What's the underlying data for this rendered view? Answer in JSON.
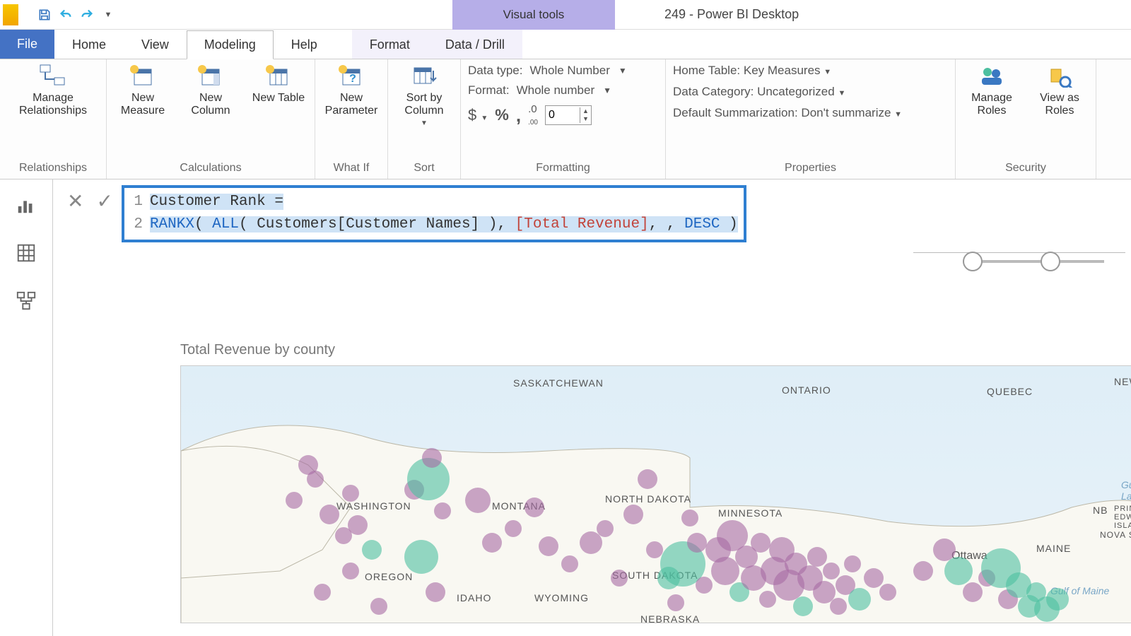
{
  "title_bar": {
    "visual_tools": "Visual tools",
    "app_title": "249 - Power BI Desktop"
  },
  "tabs": {
    "file": "File",
    "home": "Home",
    "view": "View",
    "modeling": "Modeling",
    "help": "Help",
    "format": "Format",
    "data_drill": "Data / Drill",
    "active": "Modeling"
  },
  "ribbon": {
    "relationships": {
      "manage": "Manage Relationships",
      "group": "Relationships"
    },
    "calculations": {
      "new_measure": "New Measure",
      "new_column": "New Column",
      "new_table": "New Table",
      "group": "Calculations"
    },
    "whatif": {
      "new_parameter": "New Parameter",
      "group": "What If"
    },
    "sort": {
      "sort_by_column": "Sort by Column",
      "group": "Sort"
    },
    "formatting": {
      "data_type_label": "Data type:",
      "data_type_value": "Whole Number",
      "format_label": "Format:",
      "format_value": "Whole number",
      "currency": "$",
      "percent": "%",
      "comma": ",",
      "decimals_icon": ".00",
      "decimals_value": "0",
      "group": "Formatting"
    },
    "properties": {
      "home_table_label": "Home Table:",
      "home_table_value": "Key Measures",
      "data_category_label": "Data Category:",
      "data_category_value": "Uncategorized",
      "default_summ_label": "Default Summarization:",
      "default_summ_value": "Don't summarize",
      "group": "Properties"
    },
    "security": {
      "manage_roles": "Manage Roles",
      "view_as_roles": "View as Roles",
      "group": "Security"
    }
  },
  "formula": {
    "line1_num": "1",
    "line1_text": "Customer Rank =",
    "line2_num": "2",
    "fn_rankx": "RANKX",
    "paren_open": "( ",
    "fn_all": "ALL",
    "all_arg": "( Customers[Customer Names] ), ",
    "measure": "[Total Revenue]",
    "after_measure": ", , ",
    "desc": "DESC",
    "paren_close": " )"
  },
  "map": {
    "title": "Total Revenue by county",
    "labels": {
      "saskatchewan": "SASKATCHEWAN",
      "ontario": "ONTARIO",
      "quebec": "QUEBEC",
      "newf": "NEWF",
      "washington": "WASHINGTON",
      "montana": "MONTANA",
      "ndakota": "NORTH DAKOTA",
      "minnesota": "MINNESOTA",
      "nb": "NB",
      "pei": "PRINCE EDWARD ISLAND",
      "novasco": "NOVA SCO",
      "maine": "MAINE",
      "ottawa": "Ottawa",
      "gulf_law": "Gulf Law",
      "oregon": "OREGON",
      "idaho": "IDAHO",
      "wyoming": "WYOMING",
      "sdakota": "SOUTH DAKOTA",
      "nebraska": "NEBRASKA",
      "gulf_maine": "Gulf of Maine"
    }
  }
}
